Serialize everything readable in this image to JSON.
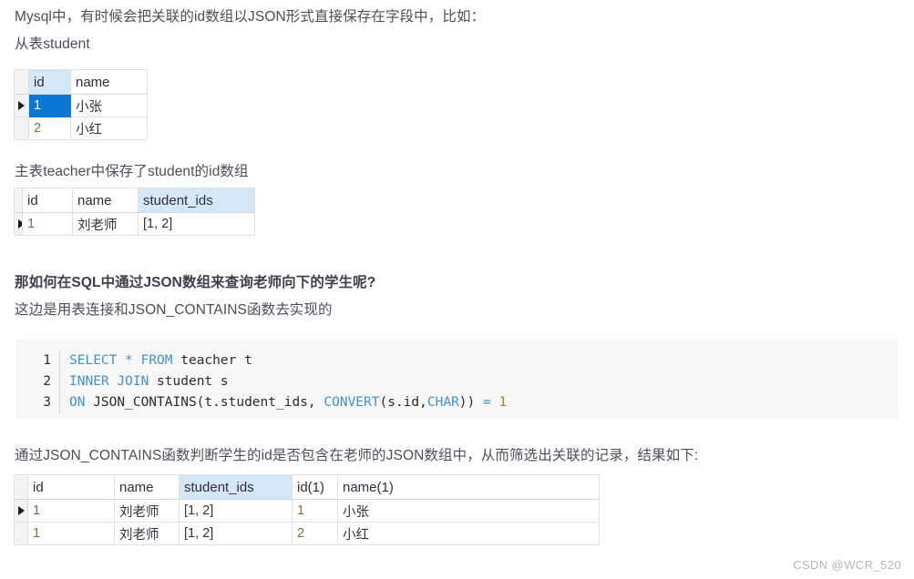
{
  "paragraphs": {
    "intro_line1": "Mysql中，有时候会把关联的id数组以JSON形式直接保存在字段中，比如：",
    "intro_line2": "从表student",
    "teacher_note": "主表teacher中保存了student的id数组",
    "question": "那如何在SQL中通过JSON数组来查询老师向下的学生呢?",
    "approach": "这边是用表连接和JSON_CONTAINS函数去实现的",
    "conclusion": "通过JSON_CONTAINS函数判断学生的id是否包含在老师的JSON数组中，从而筛选出关联的记录，结果如下:"
  },
  "student_table": {
    "columns": [
      "id",
      "name"
    ],
    "highlight_column": "id",
    "rows": [
      {
        "current": true,
        "id": "1",
        "name": "小张",
        "id_selected": true
      },
      {
        "current": false,
        "id": "2",
        "name": "小红",
        "id_selected": false
      }
    ]
  },
  "teacher_table": {
    "columns": [
      "id",
      "name",
      "student_ids"
    ],
    "highlight_column": "student_ids",
    "rows": [
      {
        "current": true,
        "id": "1",
        "name": "刘老师",
        "student_ids": "[1, 2]"
      }
    ]
  },
  "code": {
    "language": "sql",
    "lines": [
      {
        "number": "1",
        "tokens": [
          {
            "t": "SELECT",
            "c": "kw"
          },
          {
            "t": " ",
            "c": "plain"
          },
          {
            "t": "*",
            "c": "op"
          },
          {
            "t": " ",
            "c": "plain"
          },
          {
            "t": "FROM",
            "c": "kw"
          },
          {
            "t": " teacher t",
            "c": "plain"
          }
        ]
      },
      {
        "number": "2",
        "tokens": [
          {
            "t": "INNER",
            "c": "kw"
          },
          {
            "t": " ",
            "c": "plain"
          },
          {
            "t": "JOIN",
            "c": "kw"
          },
          {
            "t": " student s",
            "c": "plain"
          }
        ]
      },
      {
        "number": "3",
        "tokens": [
          {
            "t": "ON",
            "c": "kw"
          },
          {
            "t": " JSON_CONTAINS(t.student_ids, ",
            "c": "plain"
          },
          {
            "t": "CONVERT",
            "c": "kw"
          },
          {
            "t": "(s.id,",
            "c": "plain"
          },
          {
            "t": "CHAR",
            "c": "kw"
          },
          {
            "t": "))",
            "c": "plain"
          },
          {
            "t": " ",
            "c": "plain"
          },
          {
            "t": "=",
            "c": "op"
          },
          {
            "t": " ",
            "c": "plain"
          },
          {
            "t": "1",
            "c": "numlit"
          }
        ]
      }
    ]
  },
  "result_table": {
    "columns": [
      "id",
      "name",
      "student_ids",
      "id(1)",
      "name(1)"
    ],
    "highlight_column": "student_ids",
    "rows": [
      {
        "current": true,
        "id": "1",
        "name": "刘老师",
        "student_ids": "[1, 2]",
        "id1": "1",
        "name1": "小张"
      },
      {
        "current": false,
        "id": "1",
        "name": "刘老师",
        "student_ids": "[1, 2]",
        "id1": "2",
        "name1": "小红"
      }
    ]
  },
  "watermark": "CSDN @WCR_520",
  "colors": {
    "selection_blue": "#0c77d1",
    "header_highlight": "#d4e7f7",
    "keyword_blue": "#3f93c8",
    "number_orange": "#b08020",
    "text": "#4d4d5c"
  }
}
